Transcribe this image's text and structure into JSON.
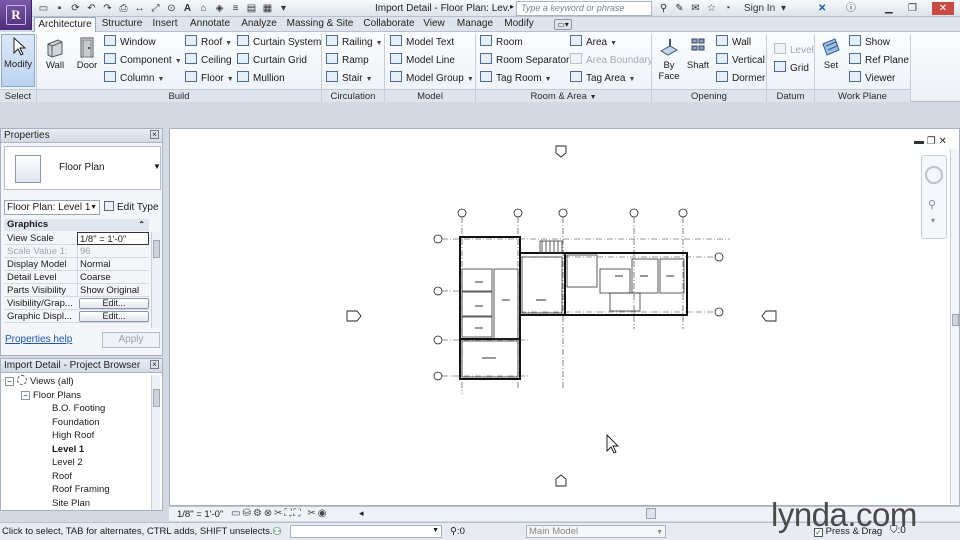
{
  "app": {
    "logo_letter": "R"
  },
  "quick_access": {
    "doc_title": "Import Detail - Floor Plan: Lev...",
    "search_placeholder": "Type a keyword or phrase",
    "sign_in": "Sign In"
  },
  "tabs": [
    "Architecture",
    "Structure",
    "Insert",
    "Annotate",
    "Analyze",
    "Massing & Site",
    "Collaborate",
    "View",
    "Manage",
    "Modify"
  ],
  "active_tab": "Architecture",
  "ribbon": {
    "select": {
      "modify": "Modify",
      "label": "Select"
    },
    "build": {
      "wall": "Wall",
      "door": "Door",
      "window": "Window",
      "component": "Component",
      "column": "Column",
      "roof": "Roof",
      "ceiling": "Ceiling",
      "floor": "Floor",
      "curtain_system": "Curtain System",
      "curtain_grid": "Curtain Grid",
      "mullion": "Mullion",
      "label": "Build"
    },
    "circulation": {
      "railing": "Railing",
      "ramp": "Ramp",
      "stair": "Stair",
      "label": "Circulation"
    },
    "model": {
      "model_text": "Model Text",
      "model_line": "Model Line",
      "model_group": "Model Group",
      "label": "Model"
    },
    "room_area": {
      "room": "Room",
      "room_separator": "Room Separator",
      "tag_room": "Tag Room",
      "area": "Area",
      "area_boundary": "Area Boundary",
      "tag_area": "Tag Area",
      "label": "Room & Area"
    },
    "opening": {
      "by_face": "By Face",
      "shaft": "Shaft",
      "wall": "Wall",
      "vertical": "Vertical",
      "dormer": "Dormer",
      "label": "Opening"
    },
    "datum": {
      "level": "Level",
      "grid": "Grid",
      "label": "Datum"
    },
    "work_plane": {
      "set": "Set",
      "show": "Show",
      "ref_plane": "Ref Plane",
      "viewer": "Viewer",
      "label": "Work Plane"
    }
  },
  "properties": {
    "title": "Properties",
    "type_name": "Floor Plan",
    "instance": "Floor Plan: Level 1",
    "edit_type": "Edit Type",
    "group": "Graphics",
    "rows": [
      {
        "k": "View Scale",
        "v": "1/8\" = 1'-0\""
      },
      {
        "k": "Scale Value    1:",
        "v": "96"
      },
      {
        "k": "Display Model",
        "v": "Normal"
      },
      {
        "k": "Detail Level",
        "v": "Coarse"
      },
      {
        "k": "Parts Visibility",
        "v": "Show Original"
      },
      {
        "k": "Visibility/Grap...",
        "v": "Edit..."
      },
      {
        "k": "Graphic Displ...",
        "v": "Edit..."
      }
    ],
    "help": "Properties help",
    "apply": "Apply"
  },
  "browser": {
    "title": "Import Detail - Project Browser",
    "root": "Views (all)",
    "floor_plans": "Floor Plans",
    "items": [
      "B.O. Footing",
      "Foundation",
      "High Roof",
      "Level 1",
      "Level 2",
      "Roof",
      "Roof Framing",
      "Site Plan"
    ],
    "active_item": "Level 1"
  },
  "view_bar": {
    "scale": "1/8\" = 1'-0\""
  },
  "status": {
    "hint": "Click to select, TAB for alternates, CTRL adds, SHIFT unselects.",
    "coord": ":0",
    "model": "Main Model",
    "press_drag": "Press & Drag",
    "filter_count": ":0"
  },
  "watermark": "lynda.com"
}
